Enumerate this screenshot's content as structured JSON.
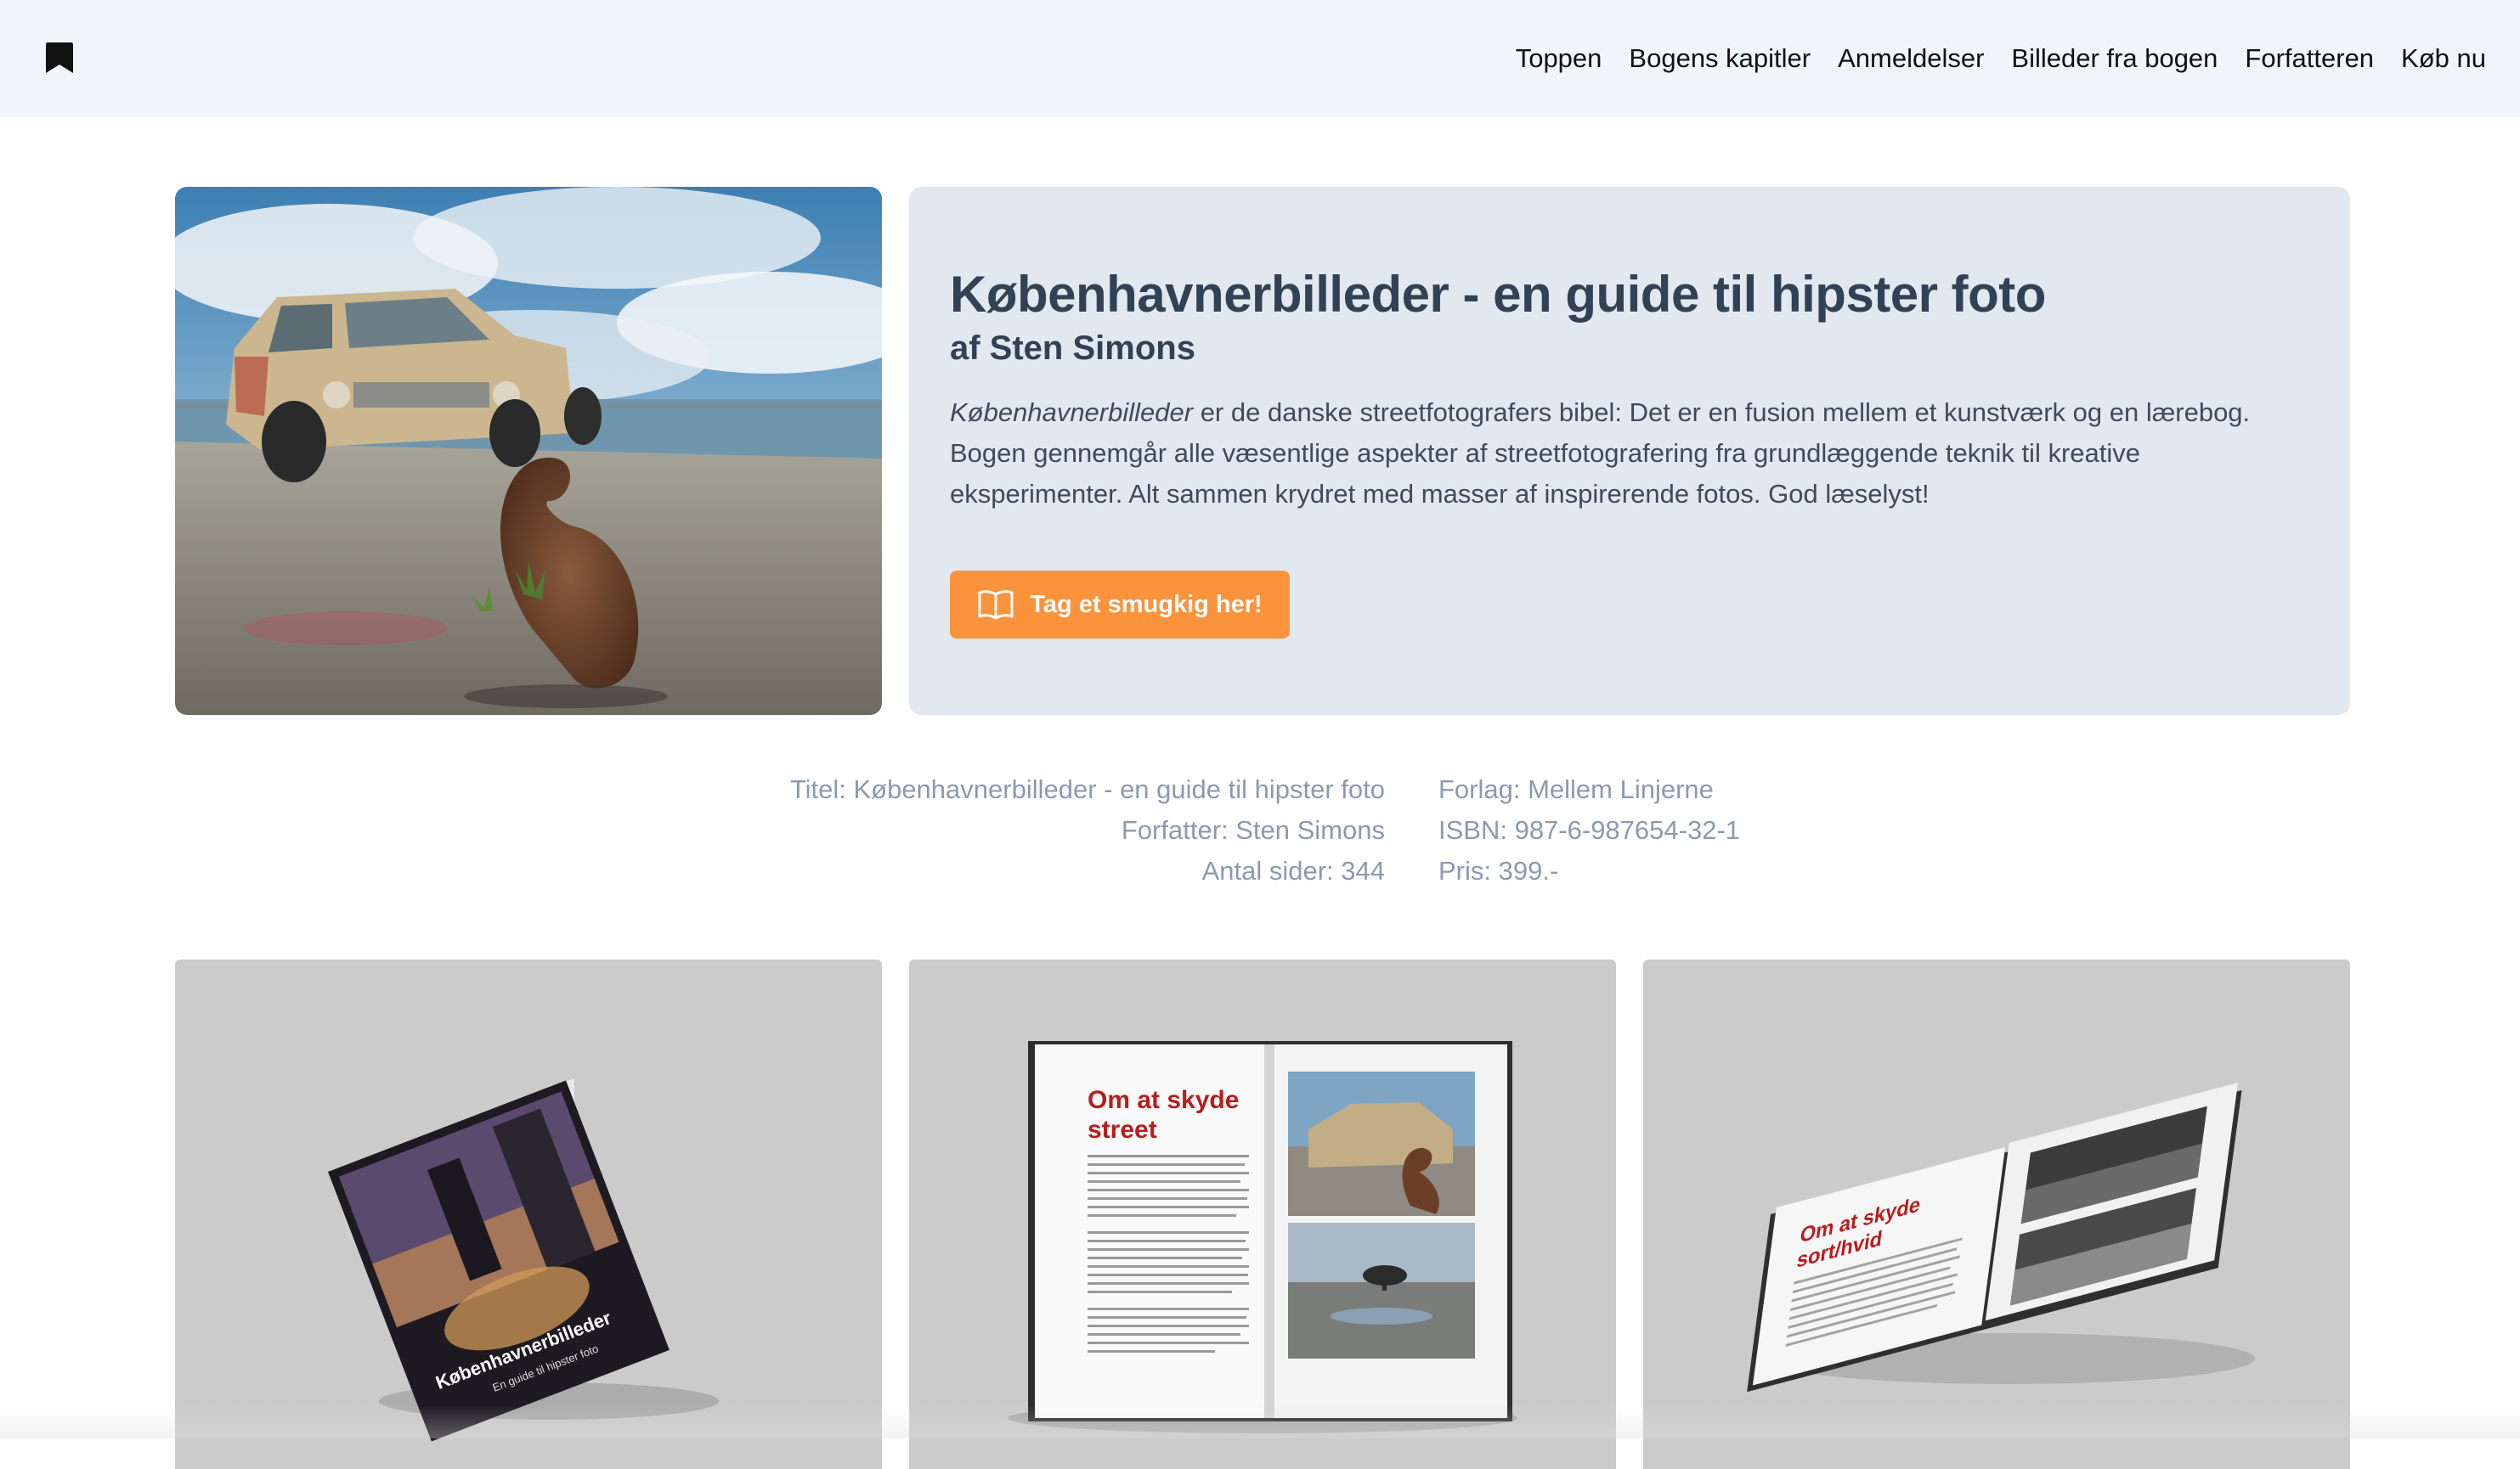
{
  "nav": {
    "logo_icon": "bookmark-icon",
    "items": [
      {
        "label": "Toppen"
      },
      {
        "label": "Bogens kapitler"
      },
      {
        "label": "Anmeldelser"
      },
      {
        "label": "Billeder fra bogen"
      },
      {
        "label": "Forfatteren"
      },
      {
        "label": "Køb nu"
      }
    ]
  },
  "hero": {
    "title": "Københavnerbilleder - en guide til hipster foto",
    "subtitle": "af Sten Simons",
    "description_em": "Københavnerbilleder",
    "description_rest": " er de danske streetfotografers bibel: Det er en fusion mellem et kunstværk og en lærebog. Bogen gennemgår alle væsentlige aspekter af streetfotografering fra grundlæggende teknik til kreative eksperimenter. Alt sammen krydret med masser af inspirerende fotos. God læselyst!",
    "cta_label": "Tag et smugkig her!",
    "cta_icon": "open-book-icon"
  },
  "details": {
    "left": [
      "Titel: Københavnerbilleder - en guide til hipster foto",
      "Forfatter: Sten Simons",
      "Antal sider: 344"
    ],
    "right": [
      "Forlag: Mellem Linjerne",
      "ISBN: 987-6-987654-32-1",
      "Pris: 399.-"
    ]
  },
  "gallery": {
    "spread_heading": [
      "Om at skyde",
      "street"
    ],
    "cover_title": "Københavnerbilleder",
    "cover_subtitle": "En guide til hipster foto",
    "angled_heading": [
      "Om at skyde",
      "sort/hvid"
    ]
  },
  "colors": {
    "accent": "#fb923c",
    "card": "#e2e8f0",
    "topbar": "#f1f5f9",
    "heading_red": "#b91c1c"
  }
}
